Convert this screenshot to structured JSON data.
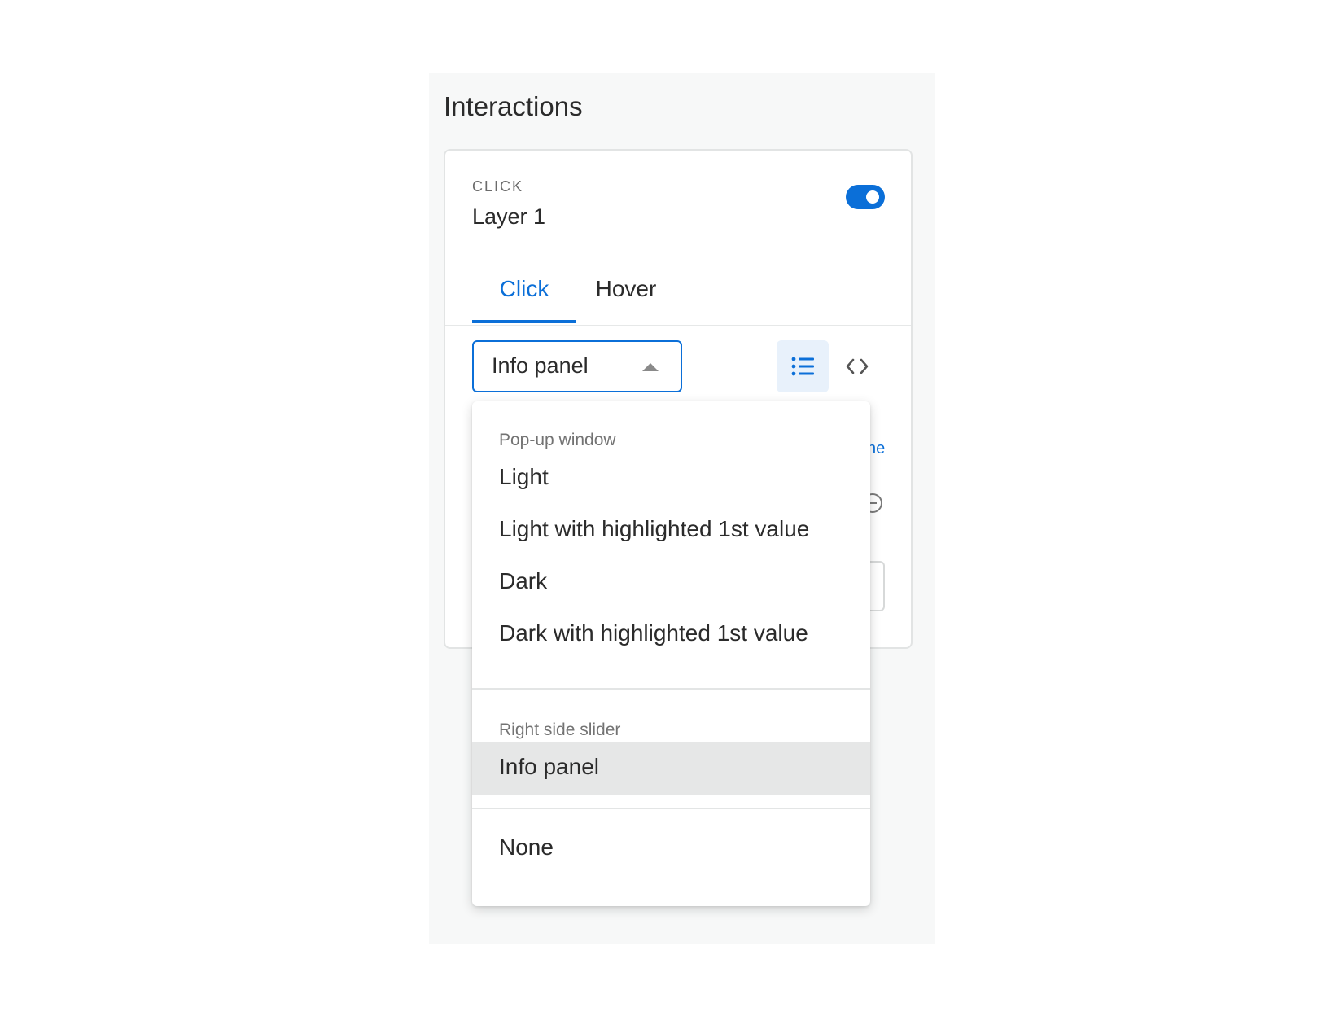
{
  "panel": {
    "title": "Interactions"
  },
  "card": {
    "kicker": "CLICK",
    "layer_name": "Layer 1",
    "toggle_on": true,
    "accent_color": "#0b6fd8"
  },
  "tabs": [
    {
      "label": "Click",
      "active": true
    },
    {
      "label": "Hover",
      "active": false
    }
  ],
  "select": {
    "value": "Info panel",
    "icon": "caret-up-icon"
  },
  "view_buttons": [
    {
      "icon": "list-icon",
      "active": true
    },
    {
      "icon": "code-icon",
      "active": false
    }
  ],
  "partial": {
    "link_fragment": "ne"
  },
  "dropdown": {
    "groups": [
      {
        "label": "Pop-up window",
        "items": [
          "Light",
          "Light with highlighted 1st value",
          "Dark",
          "Dark with highlighted 1st value"
        ]
      },
      {
        "label": "Right side slider",
        "items": [
          "Info panel"
        ]
      },
      {
        "label": "",
        "items": [
          "None"
        ]
      }
    ],
    "selected": "Info panel"
  }
}
